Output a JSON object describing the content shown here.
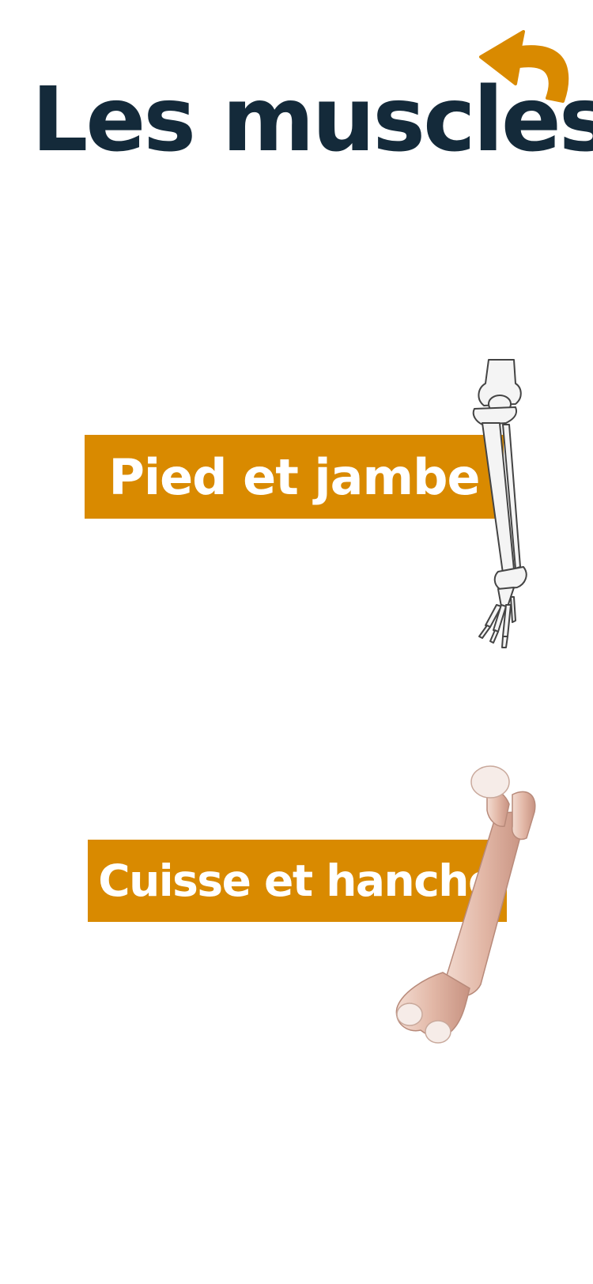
{
  "header": {
    "title": "Les muscles",
    "back_icon": "back-arrow-icon",
    "accent_color": "#d98a00",
    "title_color": "#142a3a"
  },
  "categories": [
    {
      "label": "Pied et jambe",
      "illustration": "leg-skeleton-icon"
    },
    {
      "label": "Cuisse et hanche",
      "illustration": "femur-bone-icon"
    }
  ]
}
